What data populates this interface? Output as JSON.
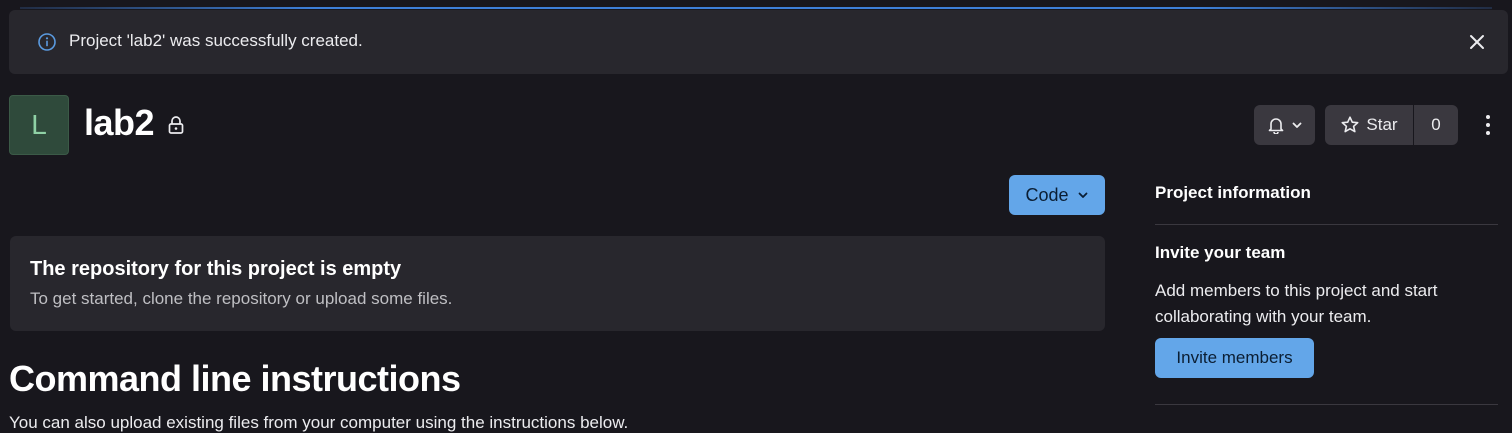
{
  "alert": {
    "message": "Project 'lab2' was successfully created.",
    "icon": "info-icon",
    "close_icon": "close-icon"
  },
  "project": {
    "avatar_letter": "L",
    "name": "lab2",
    "visibility_icon": "lock-icon"
  },
  "header_actions": {
    "notification_icon": "bell-icon",
    "star_label": "Star",
    "star_count": "0"
  },
  "main": {
    "code_button": "Code",
    "empty_repo": {
      "title": "The repository for this project is empty",
      "description": "To get started, clone the repository or upload some files."
    },
    "cli": {
      "title": "Command line instructions",
      "subtitle": "You can also upload existing files from your computer using the instructions below."
    }
  },
  "sidebar": {
    "title": "Project information",
    "invite": {
      "title": "Invite your team",
      "description": "Add members to this project and start collaborating with your team.",
      "button": "Invite members"
    }
  },
  "colors": {
    "accent": "#63a6e9",
    "background": "#18171d",
    "panel": "#28272d"
  }
}
